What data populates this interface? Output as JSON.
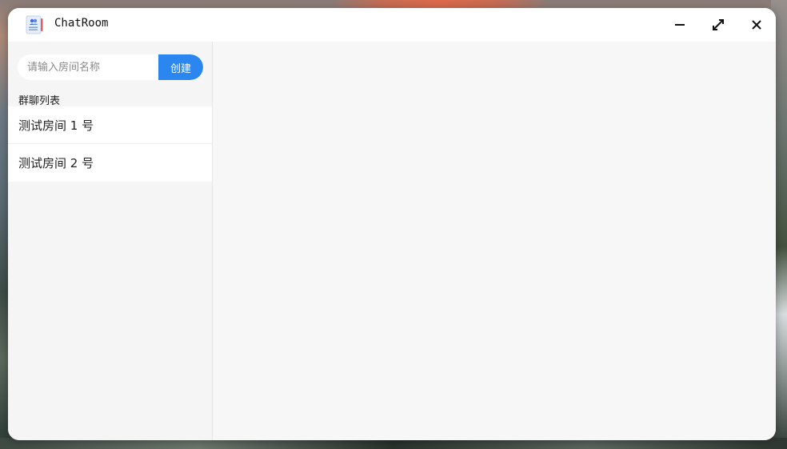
{
  "window": {
    "title": "ChatRoom",
    "icon": "chat-app-icon",
    "controls": [
      {
        "name": "minimize",
        "icon": "minimize-icon"
      },
      {
        "name": "maximize",
        "icon": "maximize-icon"
      },
      {
        "name": "close",
        "icon": "close-icon"
      }
    ]
  },
  "sidebar": {
    "room_input": {
      "placeholder": "请输入房间名称",
      "value": ""
    },
    "create_label": "创建",
    "section_label": "群聊列表",
    "rooms": [
      {
        "name": "测试房间 1 号"
      },
      {
        "name": "测试房间 2 号"
      }
    ]
  },
  "colors": {
    "accent": "#2b86f0",
    "window_bg": "#f7f7f7",
    "titlebar_bg": "#ffffff"
  }
}
